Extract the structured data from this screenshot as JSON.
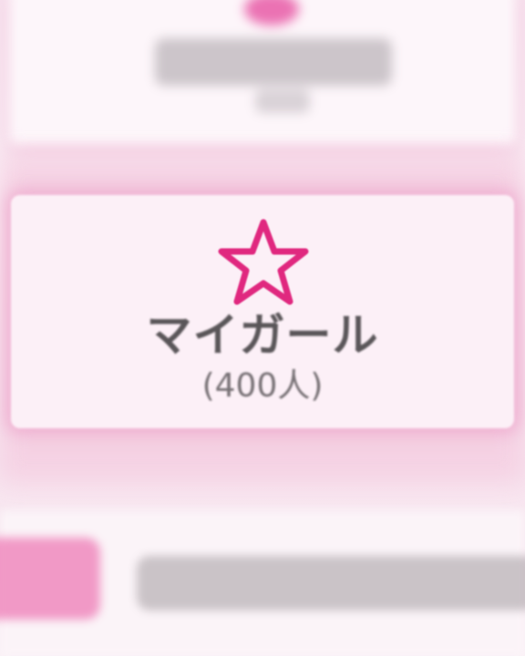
{
  "category_card": {
    "icon": "star-outline-icon",
    "title": "マイガール",
    "count_label": "(400人)",
    "accent_color": "#e0287f"
  },
  "colors": {
    "background": "#fbeff6",
    "card_background": "#fcf0f7",
    "title_text": "#5a5659",
    "count_text": "#777175"
  }
}
